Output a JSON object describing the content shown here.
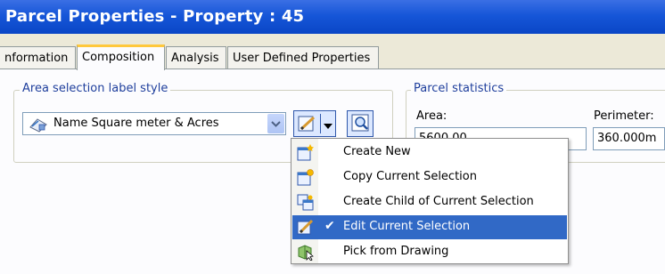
{
  "window": {
    "title": "Parcel Properties - Property : 45"
  },
  "tabs": [
    {
      "label": "nformation",
      "active": false
    },
    {
      "label": "Composition",
      "active": true
    },
    {
      "label": "Analysis",
      "active": false
    },
    {
      "label": "User Defined Properties",
      "active": false
    }
  ],
  "label_style": {
    "group_title": "Area selection label style",
    "selected": "Name Square meter & Acres"
  },
  "statistics": {
    "group_title": "Parcel statistics",
    "area_label": "Area:",
    "area_value": "5600.00",
    "perimeter_label": "Perimeter:",
    "perimeter_value": "360.000m"
  },
  "menu": {
    "items": [
      {
        "label": "Create New",
        "icon": "create-new-icon",
        "checked": false,
        "highlighted": false
      },
      {
        "label": "Copy Current Selection",
        "icon": "copy-style-icon",
        "checked": false,
        "highlighted": false
      },
      {
        "label": "Create Child of Current Selection",
        "icon": "child-style-icon",
        "checked": false,
        "highlighted": false
      },
      {
        "label": "Edit Current Selection",
        "icon": "edit-style-icon",
        "checked": true,
        "highlighted": true
      },
      {
        "label": "Pick from Drawing",
        "icon": "pick-from-drawing-icon",
        "checked": false,
        "highlighted": false
      }
    ]
  },
  "colors": {
    "title_bar": "#0a46c6",
    "highlight": "#3169c6",
    "group_title": "#1e3e9c",
    "active_tab_accent": "#ffc83c"
  }
}
